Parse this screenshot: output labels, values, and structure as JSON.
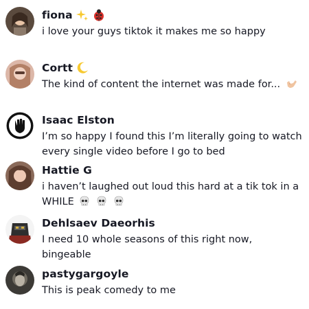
{
  "comments": [
    {
      "username": "fiona",
      "name_emojis": [
        "sparkles-icon",
        "ladybug-icon"
      ],
      "text": "i love your guys tiktok it makes me so happy"
    },
    {
      "username": "Cortt",
      "name_emojis": [
        "crescent-moon-icon"
      ],
      "text": "The kind of content the internet was made for...",
      "text_emojis": [
        "call-me-hand-icon"
      ]
    },
    {
      "username": "Isaac Elston",
      "text": "I’m so happy I found this I’m literally going to watch every single video before I go to bed"
    },
    {
      "username": "Hattie G",
      "text_line1": "i haven’t laughed out loud this hard at a tik tok in a",
      "text_line2": "WHILE",
      "text_emojis": [
        "skull-icon",
        "skull-icon",
        "skull-icon"
      ]
    },
    {
      "username": "Dehlsaev Daeorhis",
      "text": "I need 10 whole seasons of this right now, bingeable"
    },
    {
      "username": "pastygargoyle",
      "text": "This is peak comedy to me"
    }
  ]
}
